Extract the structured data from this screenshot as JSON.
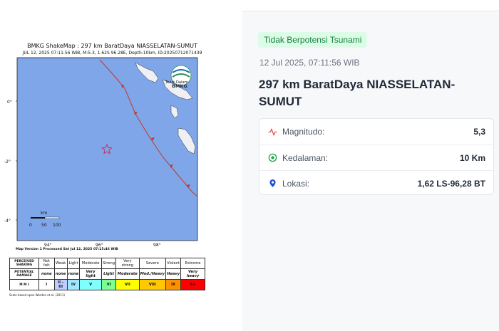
{
  "map": {
    "title": "BMKG ShakeMap : 297 km BaratDaya NIASSELATAN-SUMUT",
    "subtitle": "JUL 12, 2025 07:11:56 WIB, M:5.3, 1.62S 96.28E, Depth:10km, ID:20250712071439",
    "logo_text": "BMKG",
    "place_label": "Teluk Dalam",
    "lat_ticks": [
      "0°",
      "-2°",
      "-4°"
    ],
    "lon_ticks": [
      "94°",
      "96°",
      "98°"
    ],
    "scale_unit": "km",
    "scale_ticks": [
      "0",
      "50",
      "100"
    ],
    "version_note": "Map Version 1 Processed Sat Jul 12, 2025 07:15:46 WIB",
    "scale_note": "Scale based upon Worden et al. (2011)",
    "legend": {
      "shaking_label": "PERCEIVED SHAKING",
      "damage_label": "POTENTIAL DAMAGE",
      "mmi_label": "M M I",
      "shaking": [
        "Not felt",
        "Weak",
        "Light",
        "Moderate",
        "Strong",
        "Very strong",
        "Severe",
        "Violent",
        "Extreme"
      ],
      "damage": [
        "none",
        "none",
        "none",
        "Very light",
        "Light",
        "Moderate",
        "Mod./Heavy",
        "Heavy",
        "Very heavy"
      ],
      "mmi": [
        "I",
        "II - III",
        "IV",
        "V",
        "VI",
        "VII",
        "VIII",
        "IX",
        "X+"
      ],
      "mmi_colors": [
        "#ffffff",
        "#bfccff",
        "#a0e6ff",
        "#80ffff",
        "#7aff93",
        "#ffff00",
        "#ffc800",
        "#ff9100",
        "#ff0000"
      ]
    },
    "epicenter_color": "#e11d48",
    "sea_color": "#7fa6e8"
  },
  "info": {
    "tsunami_status": "Tidak Berpotensi Tsunami",
    "datetime": "12 Jul 2025, 07:11:56 WIB",
    "location": "297 km BaratDaya NIASSELATAN-SUMUT",
    "rows": [
      {
        "label": "Magnitudo:",
        "value": "5,3",
        "icon": "activity-icon",
        "icon_color": "#ef4444"
      },
      {
        "label": "Kedalaman:",
        "value": "10 Km",
        "icon": "target-icon",
        "icon_color": "#16a34a"
      },
      {
        "label": "Lokasi:",
        "value": "1,62 LS-96,28 BT",
        "icon": "map-pin-icon",
        "icon_color": "#1d4ed8"
      }
    ]
  }
}
